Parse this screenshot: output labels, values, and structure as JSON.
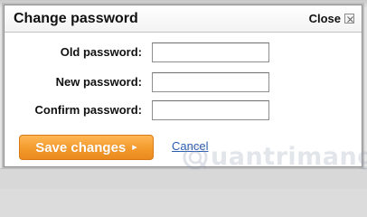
{
  "dialog": {
    "title": "Change password",
    "close_label": "Close"
  },
  "form": {
    "fields": [
      {
        "label": "Old password:",
        "value": ""
      },
      {
        "label": "New password:",
        "value": ""
      },
      {
        "label": "Confirm password:",
        "value": ""
      }
    ]
  },
  "actions": {
    "save_label": "Save changes",
    "save_arrow": "▸",
    "cancel_label": "Cancel"
  },
  "watermark": {
    "text": "uantrimang",
    "icon": "quantrimang-logo"
  },
  "colors": {
    "save_button": "#f39a2c",
    "cancel_link": "#2a5db0",
    "dialog_border": "#8f8f8f"
  }
}
